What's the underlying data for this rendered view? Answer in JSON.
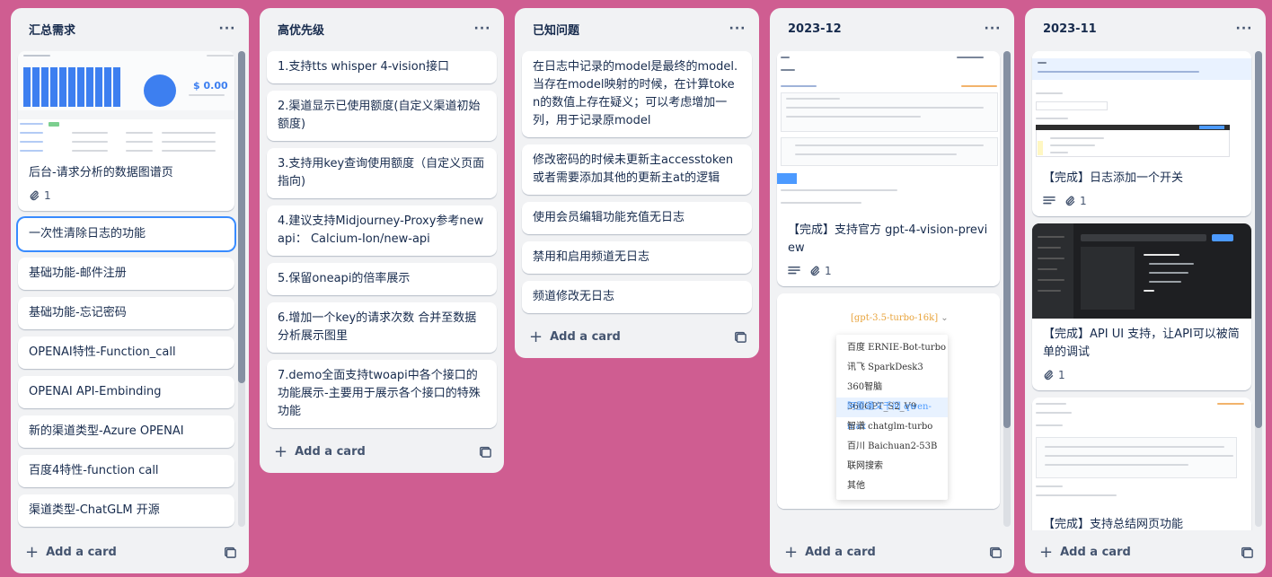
{
  "lists": [
    {
      "title": "汇总需求",
      "cards": [
        {
          "text": "后台-请求分析的数据图谱页",
          "attachments": "1"
        },
        {
          "text": "一次性清除日志的功能"
        },
        {
          "text": "基础功能-邮件注册"
        },
        {
          "text": "基础功能-忘记密码"
        },
        {
          "text": "OPENAI特性-Function_call"
        },
        {
          "text": "OPENAI API-Embinding"
        },
        {
          "text": "新的渠道类型-Azure OPENAI"
        },
        {
          "text": "百度4特性-function call"
        },
        {
          "text": "渠道类型-ChatGLM 开源"
        }
      ],
      "dashboard_value": "$ 0.00"
    },
    {
      "title": "高优先级",
      "cards": [
        {
          "text": "1.支持tts whisper 4-vision接口"
        },
        {
          "text": "2.渠道显示已使用额度(自定义渠道初始额度)"
        },
        {
          "text": "3.支持用key查询使用额度（自定义页面指向)"
        },
        {
          "text": "4.建议支持Midjourney-Proxy参考newapi： Calcium-Ion/new-api"
        },
        {
          "text": "5.保留oneapi的倍率展示"
        },
        {
          "text": "6.增加一个key的请求次数 合并至数据分析展示图里"
        },
        {
          "text": "7.demo全面支持twoapi中各个接口的功能展示-主要用于展示各个接口的特殊功能"
        }
      ]
    },
    {
      "title": "已知问题",
      "cards": [
        {
          "text": "在日志中记录的model是最终的model.当存在model映射的时候，在计算token的数值上存在疑义；可以考虑增加一列，用于记录原model"
        },
        {
          "text": "修改密码的时候未更新主accesstoken或者需要添加其他的更新主at的逻辑"
        },
        {
          "text": "使用会员编辑功能充值无日志"
        },
        {
          "text": "禁用和启用频道无日志"
        },
        {
          "text": "频道修改无日志"
        }
      ]
    },
    {
      "title": "2023-12",
      "cards": [
        {
          "text": "【完成】支持官方 gpt-4-vision-preview",
          "attachments": "1"
        }
      ],
      "dropdown": {
        "selected": "[gpt-3.5-turbo-16k]",
        "options": [
          "百度 ERNIE-Bot-turbo",
          "讯飞 SparkDesk3",
          "360智脑 360GPT_S2_V9",
          "阿里通义千问 qwen-max",
          "智谱 chatglm-turbo",
          "百川 Baichuan2-53B",
          "联网搜索",
          "其他"
        ]
      }
    },
    {
      "title": "2023-11",
      "cards": [
        {
          "text": "【完成】日志添加一个开关",
          "attachments": "1"
        },
        {
          "text": "【完成】API UI 支持，让API可以被简单的调试",
          "attachments": "1"
        },
        {
          "text": "【完成】支持总结网页功能"
        }
      ]
    }
  ],
  "add_card_label": "Add a card",
  "colors": {
    "background": "#cf5d91",
    "list": "#f1f2f4",
    "accent": "#388bff",
    "chart_bar": "#3d7ff0"
  }
}
